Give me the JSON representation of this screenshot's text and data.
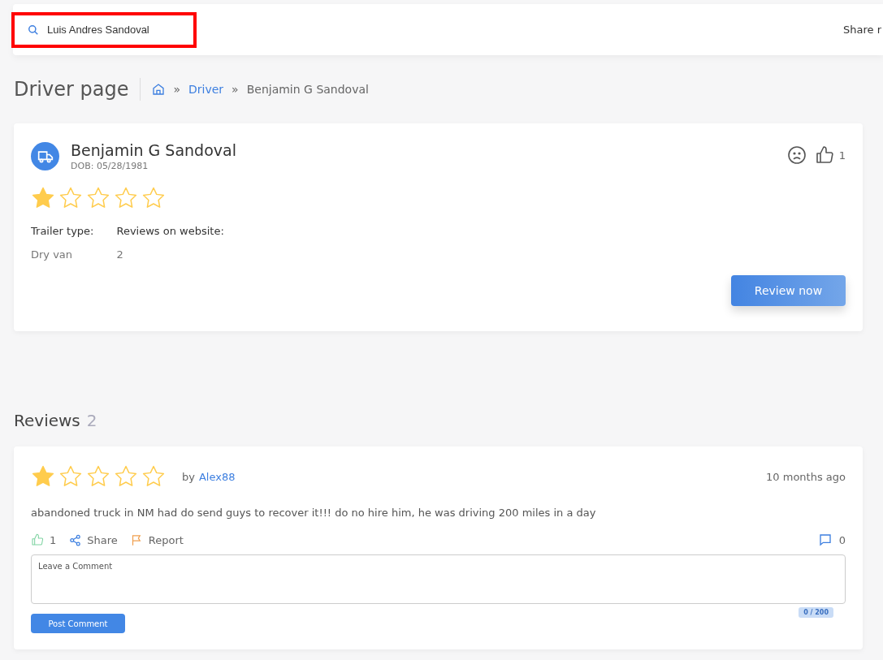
{
  "search": {
    "value": "Luis Andres Sandoval",
    "highlighted": true
  },
  "topbar": {
    "share_text": "Share r"
  },
  "page_title": "Driver page",
  "breadcrumb": [
    {
      "separator": "»",
      "label": "Driver",
      "link": true
    },
    {
      "separator": "»",
      "label": "Benjamin G Sandoval",
      "link": false
    }
  ],
  "driver": {
    "name": "Benjamin G Sandoval",
    "dob": "DOB: 05/28/1981",
    "stars": 1,
    "likes": "1",
    "fields": [
      {
        "label": "Trailer type:",
        "value": "Dry van"
      },
      {
        "label": "Reviews on website:",
        "value": "2"
      }
    ],
    "review_button": "Review now"
  },
  "reviews_heading": {
    "title": "Reviews",
    "count": "2"
  },
  "reviews": [
    {
      "stars": 1,
      "by": "by",
      "author": "Alex88",
      "time": "10 months ago",
      "text": "abandoned truck in NM had do send guys to recover it!!! do no hire him, he was driving 200 miles in a day",
      "likes": "1",
      "share": "Share",
      "report": "Report",
      "comments": "0",
      "comment_placeholder": "Leave a Comment",
      "counter": "0 / 200",
      "post": "Post Comment"
    }
  ]
}
